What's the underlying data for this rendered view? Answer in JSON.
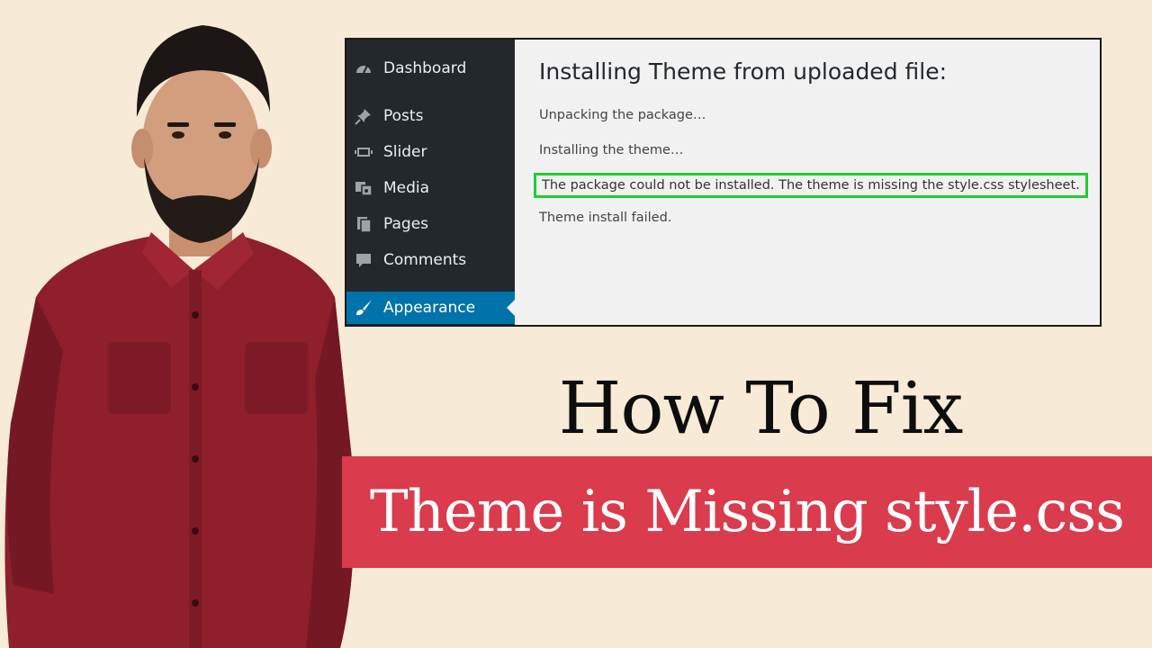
{
  "wp_admin": {
    "menu": [
      {
        "label": "Dashboard",
        "icon": "dashboard-icon"
      },
      {
        "label": "Posts",
        "icon": "pushpin-icon"
      },
      {
        "label": "Slider",
        "icon": "slider-icon"
      },
      {
        "label": "Media",
        "icon": "media-icon"
      },
      {
        "label": "Pages",
        "icon": "pages-icon"
      },
      {
        "label": "Comments",
        "icon": "comment-icon"
      },
      {
        "label": "Appearance",
        "icon": "paintbrush-icon",
        "active": true
      }
    ],
    "heading": "Installing Theme from uploaded file:",
    "messages": {
      "unpacking": "Unpacking the package…",
      "installing": "Installing the theme…",
      "error": "The package could not be installed. The theme is missing the style.css stylesheet.",
      "failed": "Theme install failed."
    }
  },
  "title_line1": "How To Fix",
  "title_line2": "Theme is Missing style.css",
  "colors": {
    "background": "#f7ead6",
    "banner": "#da3b4d",
    "sidebar": "#23282d",
    "active_menu": "#0073aa",
    "error_highlight": "#22cc33",
    "shirt": "#8e1f2b"
  }
}
